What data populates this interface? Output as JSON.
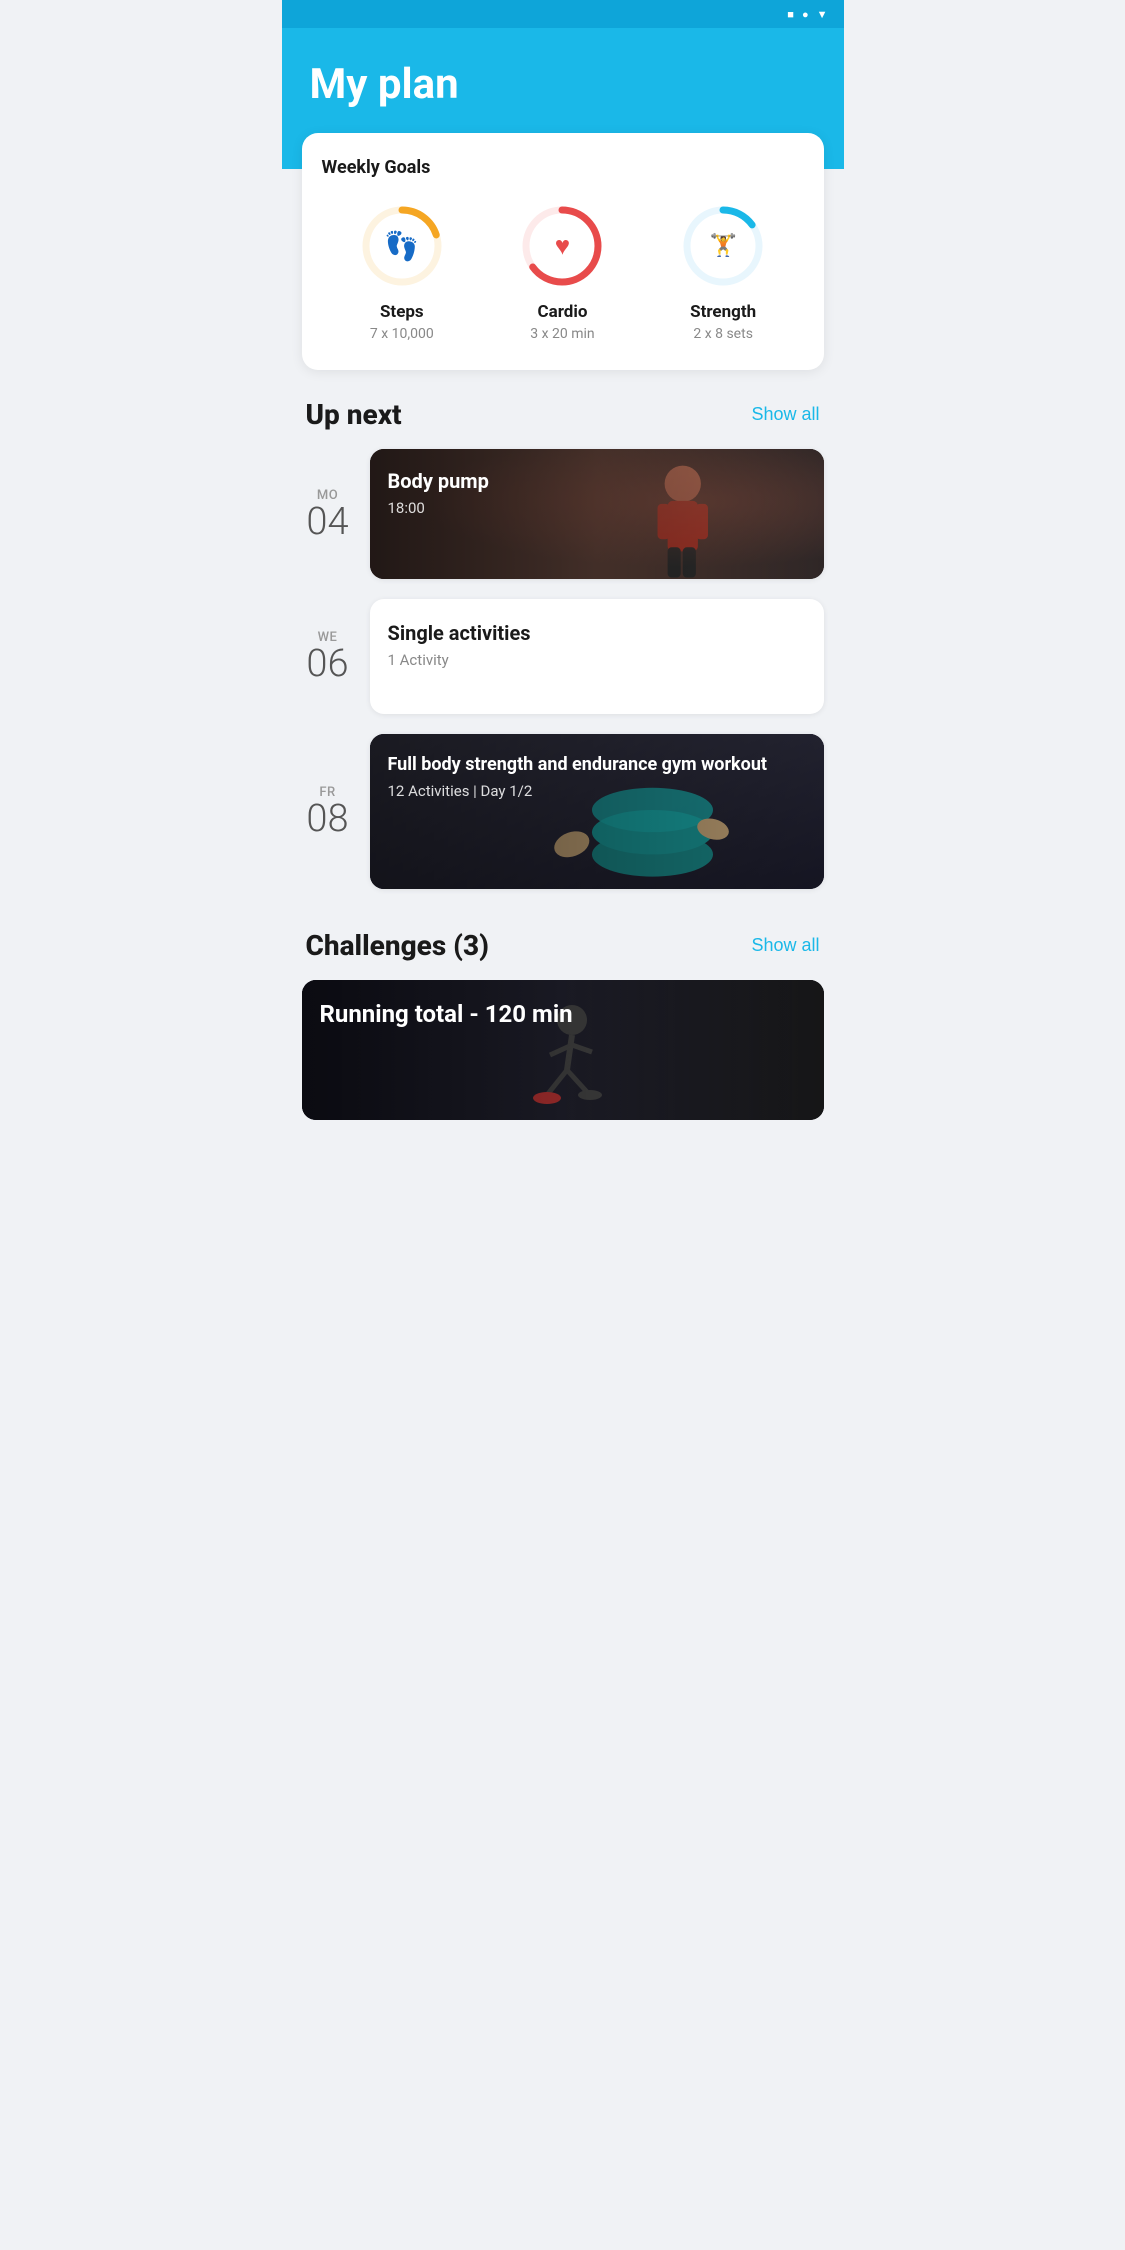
{
  "statusBar": {
    "icons": [
      "square",
      "circle",
      "triangle-down"
    ]
  },
  "header": {
    "title": "My plan"
  },
  "weeklyGoals": {
    "sectionTitle": "Weekly Goals",
    "goals": [
      {
        "id": "steps",
        "name": "Steps",
        "detail": "7 x 10,000",
        "icon": "👣",
        "color": "#f5a623",
        "bgColor": "#fdf3e0",
        "progress": 0.2,
        "strokeColor": "#f5a623"
      },
      {
        "id": "cardio",
        "name": "Cardio",
        "detail": "3 x 20 min",
        "icon": "❤",
        "color": "#e84b4b",
        "bgColor": "#fdeaea",
        "progress": 0.65,
        "strokeColor": "#e84b4b"
      },
      {
        "id": "strength",
        "name": "Strength",
        "detail": "2 x 8 sets",
        "icon": "🏋",
        "color": "#1ab8e8",
        "bgColor": "#e8f6fd",
        "progress": 0.15,
        "strokeColor": "#1ab8e8"
      }
    ]
  },
  "upNext": {
    "sectionTitle": "Up next",
    "showAllLabel": "Show all",
    "items": [
      {
        "dayName": "MO",
        "dayNum": "04",
        "title": "Body pump",
        "subtitle": "18:00",
        "hasImage": true,
        "imageType": "gym"
      },
      {
        "dayName": "WE",
        "dayNum": "06",
        "title": "Single activities",
        "subtitle": "1 Activity",
        "hasImage": false,
        "imageType": "white"
      },
      {
        "dayName": "FR",
        "dayNum": "08",
        "title": "Full body strength and endurance gym workout",
        "subtitle": "12 Activities | Day 1/2",
        "hasImage": true,
        "imageType": "strength"
      }
    ]
  },
  "challenges": {
    "sectionTitle": "Challenges (3)",
    "showAllLabel": "Show all",
    "items": [
      {
        "title": "Running total - 120 min",
        "imageType": "running"
      }
    ]
  },
  "footer": {
    "runningTotal": "Running total 120 min"
  }
}
